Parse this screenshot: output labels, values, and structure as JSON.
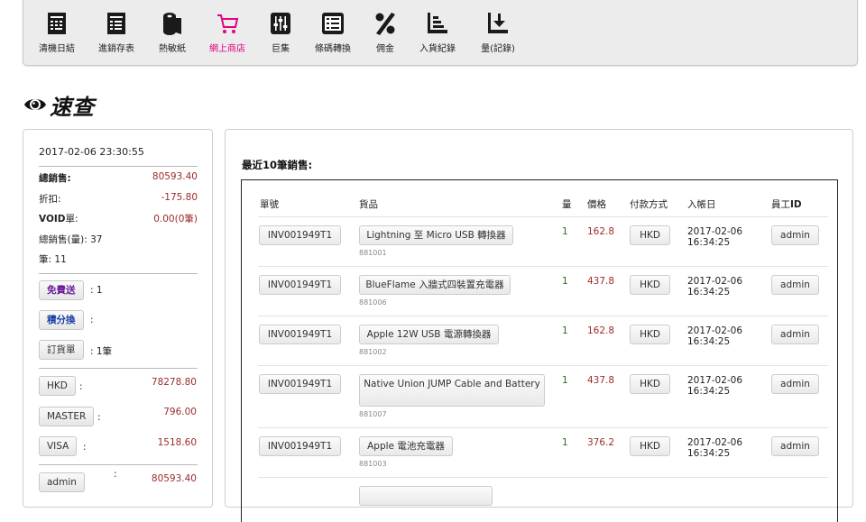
{
  "toolbar": {
    "items": [
      {
        "label": "清機日結",
        "icon": "register-report-icon"
      },
      {
        "label": "進銷存表",
        "icon": "inventory-table-icon"
      },
      {
        "label": "熱敏紙",
        "icon": "paper-roll-icon"
      },
      {
        "label": "網上商店",
        "icon": "shopping-cart-icon",
        "active": true
      },
      {
        "label": "巨集",
        "icon": "sliders-icon"
      },
      {
        "label": "條碼轉換",
        "icon": "barcode-list-icon"
      },
      {
        "label": "佣金",
        "icon": "percent-icon"
      },
      {
        "label": "入貨紀錄",
        "icon": "stock-in-icon"
      },
      {
        "label": "量(記錄)",
        "icon": "quantity-log-icon"
      }
    ],
    "active_color": "#e4007f"
  },
  "page_title": "速查",
  "summary": {
    "datetime": "2017-02-06 23:30:55",
    "total_sales_label": "總銷售:",
    "total_sales": "80593.40",
    "discount_label": "折扣:",
    "discount": "-175.80",
    "void_label_bold": "VOID",
    "void_label_rest": "單:",
    "void_value": "0.00(0筆)",
    "qty_label": "總銷售(量):",
    "qty_value": "37",
    "count_label": "筆:",
    "count_value": "11",
    "free_shipping_btn": "免費送",
    "free_shipping_value": ": 1",
    "points_btn": "積分換",
    "points_value": ":",
    "order_btn": "訂貨單",
    "order_value": ": 1筆",
    "payments": [
      {
        "method": "HKD",
        "sep": ":",
        "amount": "78278.80"
      },
      {
        "method": "MASTER",
        "sep": ":",
        "amount": "796.00"
      },
      {
        "method": "VISA",
        "sep": ":",
        "amount": "1518.60"
      }
    ],
    "staff": {
      "name": "admin",
      "sep": ":",
      "amount": "80593.40"
    }
  },
  "recent": {
    "title_prefix": "最近",
    "title_count": "10",
    "title_suffix": "筆銷售:",
    "headers": {
      "invoice": "單號",
      "item": "貨品",
      "qty": "量",
      "price": "價格",
      "payment": "付款方式",
      "date": "入帳日",
      "staff_prefix": "員工",
      "staff_bold": "ID"
    },
    "rows": [
      {
        "invoice": "INV001949T1",
        "item": "Lightning 至 Micro USB 轉換器",
        "sku": "881001",
        "qty": "1",
        "price": "162.8",
        "payment": "HKD",
        "date": "2017-02-06",
        "time": "16:34:25",
        "staff": "admin"
      },
      {
        "invoice": "INV001949T1",
        "item": "BlueFlame 入牆式四裝置充電器",
        "sku": "881006",
        "qty": "1",
        "price": "437.8",
        "payment": "HKD",
        "date": "2017-02-06",
        "time": "16:34:25",
        "staff": "admin"
      },
      {
        "invoice": "INV001949T1",
        "item": "Apple 12W USB 電源轉換器",
        "sku": "881002",
        "qty": "1",
        "price": "162.8",
        "payment": "HKD",
        "date": "2017-02-06",
        "time": "16:34:25",
        "staff": "admin"
      },
      {
        "invoice": "INV001949T1",
        "item": "Native Union JUMP Cable and Battery",
        "sku": "881007",
        "qty": "1",
        "price": "437.8",
        "payment": "HKD",
        "date": "2017-02-06",
        "time": "16:34:25",
        "staff": "admin"
      },
      {
        "invoice": "INV001949T1",
        "item": "Apple 電池充電器",
        "sku": "881003",
        "qty": "1",
        "price": "376.2",
        "payment": "HKD",
        "date": "2017-02-06",
        "time": "16:34:25",
        "staff": "admin"
      }
    ]
  }
}
